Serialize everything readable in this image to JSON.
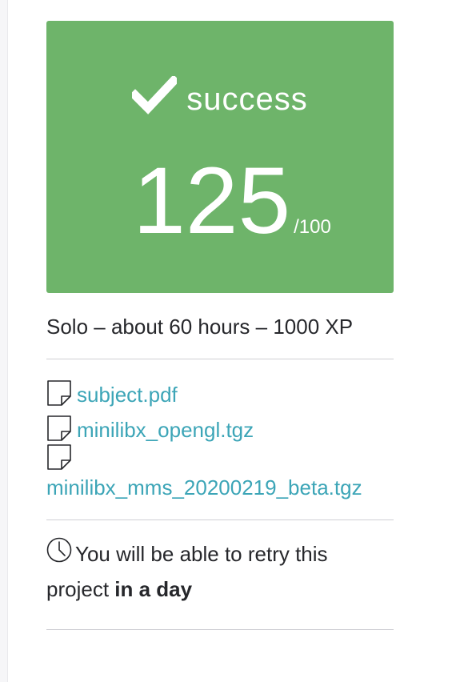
{
  "result": {
    "status": "success",
    "score": "125",
    "max": "/100",
    "accent_color": "#6eb46a",
    "icon": "checkmark-icon"
  },
  "project_meta": "Solo – about 60 hours – 1000 XP",
  "attachments": [
    {
      "name": "subject.pdf",
      "icon": "file-icon"
    },
    {
      "name": "minilibx_opengl.tgz",
      "icon": "file-icon"
    },
    {
      "name": "minilibx_mms_20200219_beta.tgz",
      "icon": "file-icon"
    }
  ],
  "retry": {
    "icon": "clock-icon",
    "text": "You will be able to retry this project ",
    "emphasis": "in a day"
  },
  "link_color": "#3ca5b7"
}
